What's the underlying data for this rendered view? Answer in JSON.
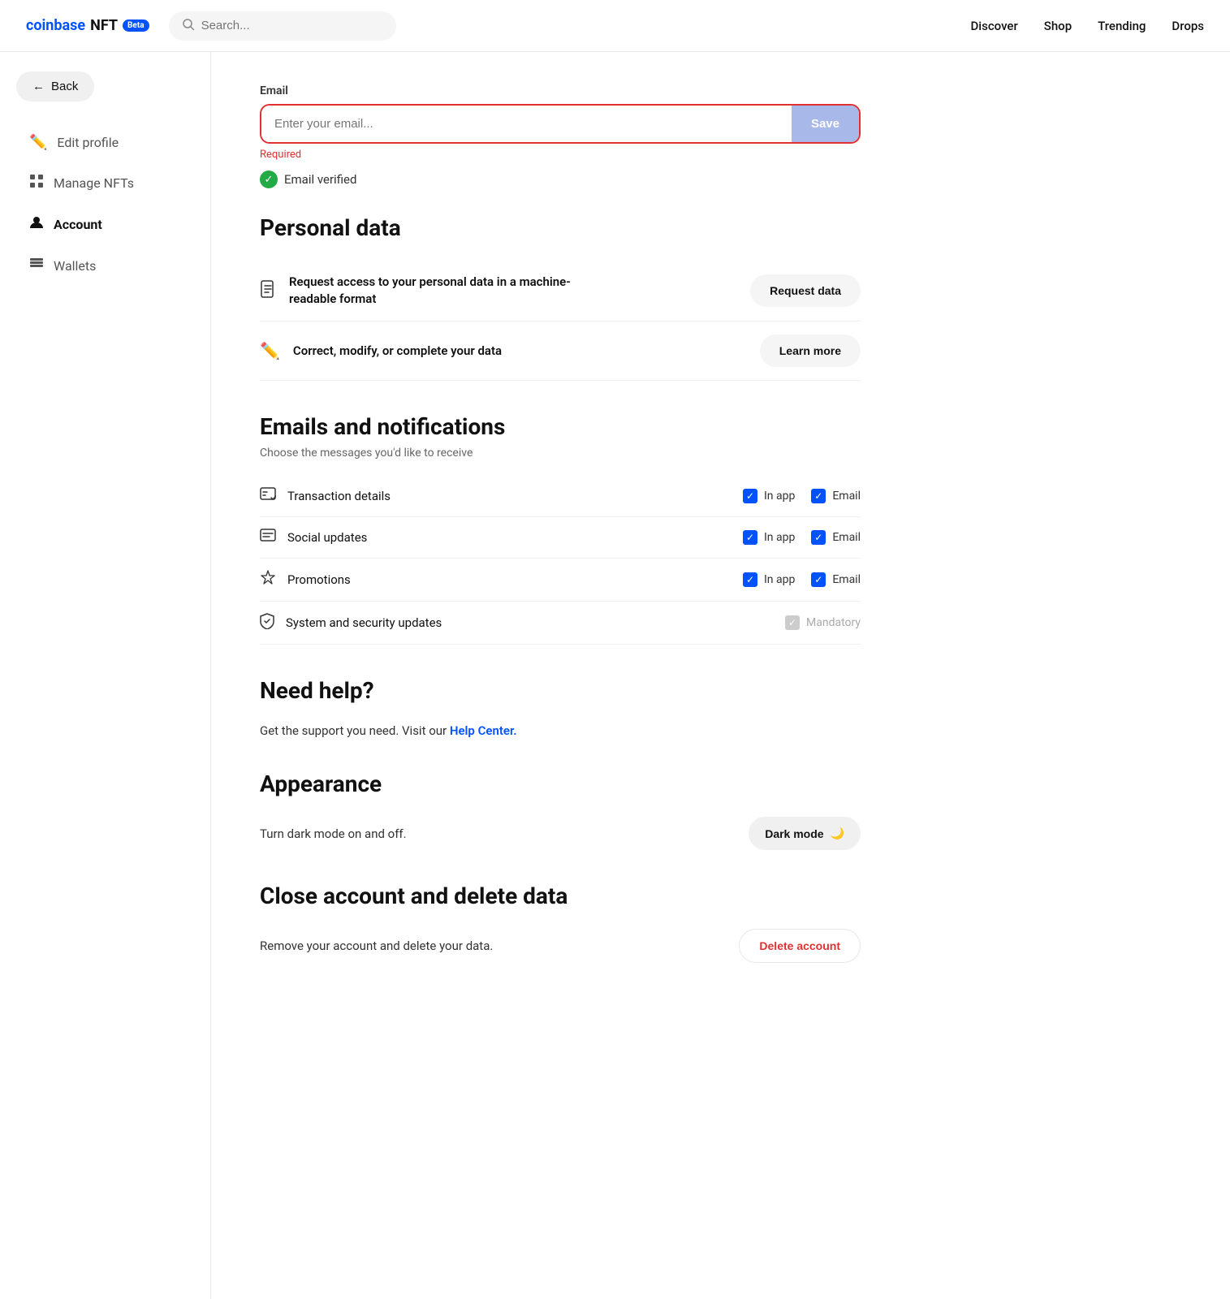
{
  "topnav": {
    "logo_coinbase": "coinbase",
    "logo_nft": "NFT",
    "beta_badge": "Beta",
    "search_placeholder": "Search...",
    "nav_links": [
      {
        "label": "Discover",
        "id": "discover"
      },
      {
        "label": "Shop",
        "id": "shop"
      },
      {
        "label": "Trending",
        "id": "trending"
      },
      {
        "label": "Drops",
        "id": "drops"
      }
    ]
  },
  "sidebar": {
    "back_label": "Back",
    "items": [
      {
        "label": "Edit profile",
        "id": "edit-profile",
        "icon": "✏️",
        "active": false
      },
      {
        "label": "Manage NFTs",
        "id": "manage-nfts",
        "icon": "▦",
        "active": false
      },
      {
        "label": "Account",
        "id": "account",
        "icon": "👤",
        "active": true
      },
      {
        "label": "Wallets",
        "id": "wallets",
        "icon": "▤",
        "active": false
      }
    ]
  },
  "email_section": {
    "label": "Email",
    "placeholder": "Enter your email...",
    "save_button": "Save",
    "required_text": "Required",
    "verified_text": "Email verified"
  },
  "personal_data": {
    "heading": "Personal data",
    "rows": [
      {
        "id": "request-data",
        "icon": "📄",
        "text": "Request access to your personal data in a machine-readable format",
        "button": "Request data"
      },
      {
        "id": "learn-more",
        "icon": "✏️",
        "text": "Correct, modify, or complete your data",
        "button": "Learn more"
      }
    ]
  },
  "notifications": {
    "heading": "Emails and notifications",
    "subtitle": "Choose the messages you'd like to receive",
    "rows": [
      {
        "id": "transaction-details",
        "icon": "💬",
        "label": "Transaction details",
        "inapp": true,
        "email": true,
        "mandatory": false
      },
      {
        "id": "social-updates",
        "icon": "💭",
        "label": "Social updates",
        "inapp": true,
        "email": true,
        "mandatory": false
      },
      {
        "id": "promotions",
        "icon": "🏷️",
        "label": "Promotions",
        "inapp": true,
        "email": true,
        "mandatory": false
      },
      {
        "id": "system-security",
        "icon": "🛡️",
        "label": "System and security updates",
        "inapp": false,
        "email": false,
        "mandatory": true
      }
    ],
    "inapp_label": "In app",
    "email_label": "Email",
    "mandatory_label": "Mandatory"
  },
  "help": {
    "heading": "Need help?",
    "text_before": "Get the support you need. Visit our ",
    "link_text": "Help Center.",
    "text_after": ""
  },
  "appearance": {
    "heading": "Appearance",
    "description": "Turn dark mode on and off.",
    "button": "Dark mode"
  },
  "delete_account": {
    "heading": "Close account and delete data",
    "description": "Remove your account and delete your data.",
    "button": "Delete account"
  }
}
